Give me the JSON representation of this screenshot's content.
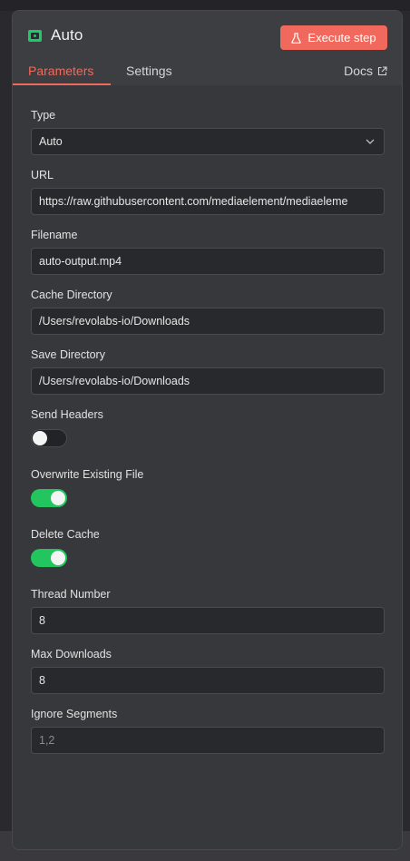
{
  "node": {
    "title": "Auto",
    "execute_label": "Execute step"
  },
  "tabs": {
    "parameters": "Parameters",
    "settings": "Settings",
    "docs": "Docs"
  },
  "fields": {
    "type": {
      "label": "Type",
      "value": "Auto"
    },
    "url": {
      "label": "URL",
      "value": "https://raw.githubusercontent.com/mediaelement/mediaeleme"
    },
    "filename": {
      "label": "Filename",
      "value": "auto-output.mp4"
    },
    "cache_directory": {
      "label": "Cache Directory",
      "value": "/Users/revolabs-io/Downloads"
    },
    "save_directory": {
      "label": "Save Directory",
      "value": "/Users/revolabs-io/Downloads"
    },
    "send_headers": {
      "label": "Send Headers",
      "on": false
    },
    "overwrite_existing_file": {
      "label": "Overwrite Existing File",
      "on": true
    },
    "delete_cache": {
      "label": "Delete Cache",
      "on": true
    },
    "thread_number": {
      "label": "Thread Number",
      "value": "8"
    },
    "max_downloads": {
      "label": "Max Downloads",
      "value": "8"
    },
    "ignore_segments": {
      "label": "Ignore Segments",
      "value": "",
      "placeholder": "1,2"
    }
  },
  "colors": {
    "accent": "#f0695c",
    "toggle_on": "#22c55e",
    "node_icon": "#1ec96a"
  },
  "icons": {
    "node": "node-icon",
    "execute": "flask-icon",
    "docs": "external-link-icon",
    "select": "chevron-down-icon"
  }
}
